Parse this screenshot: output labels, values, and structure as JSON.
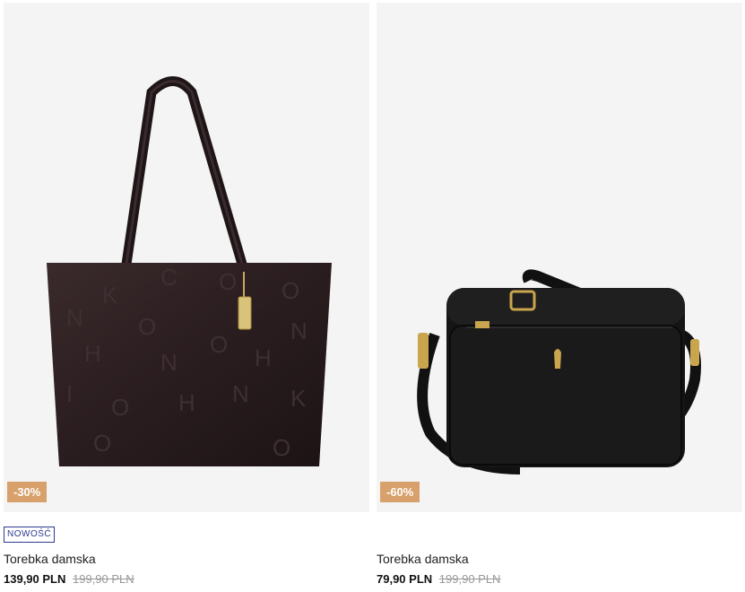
{
  "products": [
    {
      "discount": "-30%",
      "badge": "NOWOŚĆ",
      "title": "Torebka damska",
      "price": "139,90 PLN",
      "old_price": "199,90 PLN",
      "image_icon": "tote-bag-image"
    },
    {
      "discount": "-60%",
      "badge": "",
      "title": "Torebka damska",
      "price": "79,90 PLN",
      "old_price": "199,90 PLN",
      "image_icon": "crossbody-bag-image"
    }
  ],
  "colors": {
    "discount_bg": "#d8a06a",
    "badge_border": "#2b3a8f",
    "image_bg": "#f4f4f4"
  }
}
